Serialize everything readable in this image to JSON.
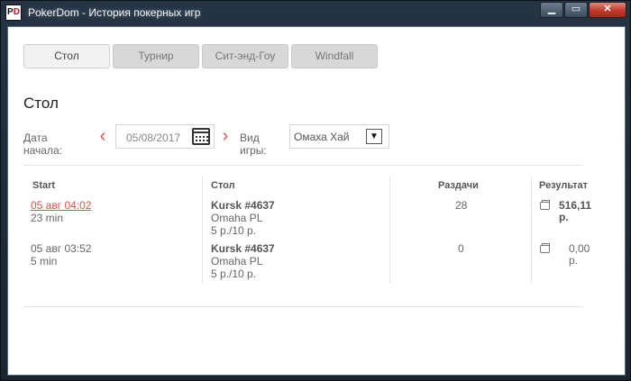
{
  "window": {
    "title": "PokerDom - История покерных игр",
    "icon_letters": [
      "P",
      "D"
    ],
    "accent": "#d9534f"
  },
  "tabs": [
    {
      "label": "Стол",
      "active": true
    },
    {
      "label": "Турнир",
      "active": false
    },
    {
      "label": "Сит-энд-Гоу",
      "active": false
    },
    {
      "label": "Windfall",
      "active": false
    }
  ],
  "section_title": "Стол",
  "filters": {
    "date_label": "Дата начала:",
    "date_value": "05/08/2017",
    "prev_icon": "chevron-left-icon",
    "next_icon": "chevron-right-icon",
    "calendar_icon": "calendar-icon",
    "game_label": "Вид игры:",
    "game_value": "Омаха Хай"
  },
  "table": {
    "columns": [
      "Start",
      "Стол",
      "Раздачи",
      "Результат"
    ],
    "rows": [
      {
        "start": "05 авг 04:02",
        "duration": "23 min",
        "table": "Kursk #4637",
        "game": "Omaha PL",
        "stakes": "5 р./10 р.",
        "hands": "28",
        "result": "516,11 р.",
        "highlight": true
      },
      {
        "start": "05 авг 03:52",
        "duration": "5 min",
        "table": "Kursk #4637",
        "game": "Omaha PL",
        "stakes": "5 р./10 р.",
        "hands": "0",
        "result": "0,00 р.",
        "highlight": false
      }
    ]
  }
}
